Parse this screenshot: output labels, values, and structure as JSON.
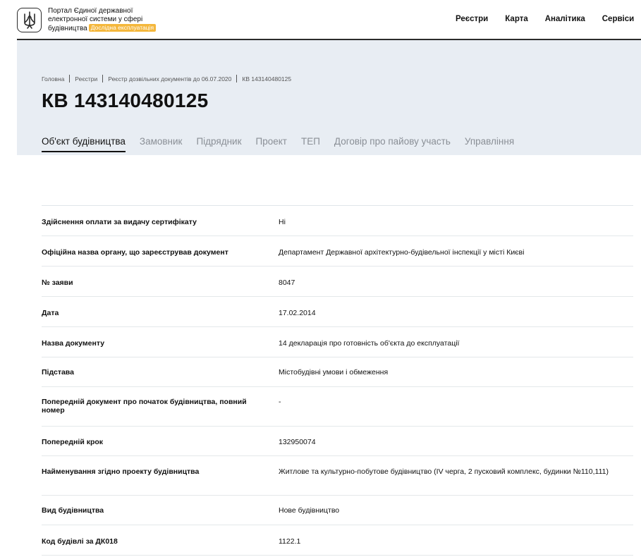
{
  "header": {
    "logo_icon": "trident-icon",
    "brand_lines": [
      "Портал Єдиної державної",
      "електронної системи у сфері",
      "будівництва"
    ],
    "badge": "Дослідна експлуатація",
    "badge_color": "#f4b73c",
    "nav": [
      "Реєстри",
      "Карта",
      "Аналітика",
      "Сервіси"
    ]
  },
  "breadcrumb": [
    "Головна",
    "Реєстри",
    "Реєстр дозвільних документів до 06.07.2020",
    "КВ 143140480125"
  ],
  "page_title": "КВ 143140480125",
  "tabs": [
    "Об'єкт будівництва",
    "Замовник",
    "Підрядник",
    "Проект",
    "ТЕП",
    "Договір про пайову участь",
    "Управління"
  ],
  "active_tab": "Об'єкт будівництва",
  "rows": [
    {
      "label": "Здійснення оплати за видачу сертифікату",
      "value": "Ні"
    },
    {
      "label": "Офіційна назва органу, що зареєстрував документ",
      "value": "Департамент Державної архітектурно-будівельної інспекції у місті Києві"
    },
    {
      "label": "№ заяви",
      "value": "8047"
    },
    {
      "label": "Дата",
      "value": "17.02.2014"
    },
    {
      "label": "Назва документу",
      "value": "14 декларація про готовність об'єкта до експлуатації"
    },
    {
      "label": "Підстава",
      "value": "Містобудівні умови і обмеження"
    },
    {
      "label": "Попередній документ про початок будівництва, повний номер",
      "value": "-"
    },
    {
      "label": "Попередній крок",
      "value": "132950074"
    },
    {
      "label": "Найменування згідно проекту будівництва",
      "value": "Житлове та культурно-побутове будівництво (IV черга, 2 пусковий комплекс, будинки №110,111)"
    },
    {
      "label": "Вид будівництва",
      "value": "Нове будівництво"
    },
    {
      "label": "Код будівлі за ДК018",
      "value": "1122.1"
    }
  ]
}
